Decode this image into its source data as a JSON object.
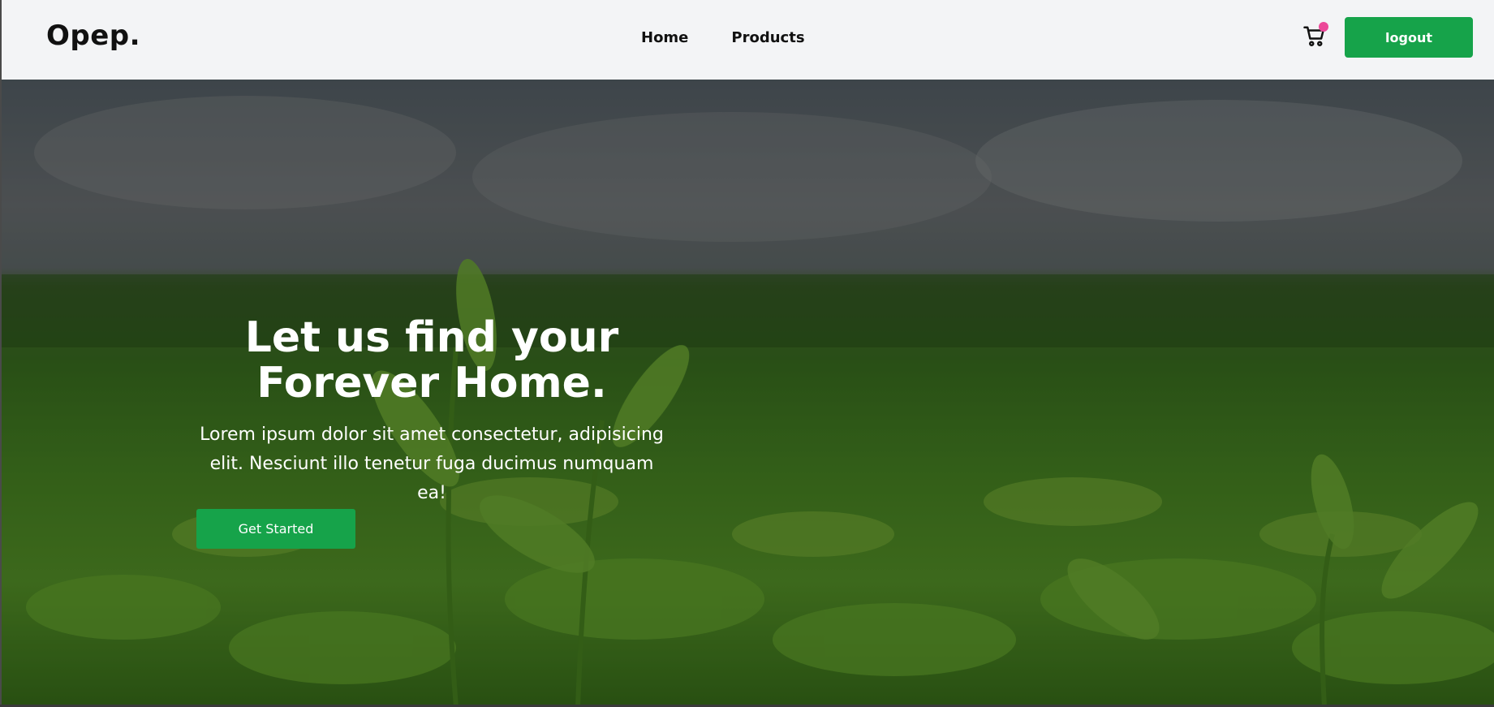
{
  "header": {
    "logo": "Opep.",
    "nav": [
      {
        "label": "Home"
      },
      {
        "label": "Products"
      }
    ],
    "cart_icon": "shopping-cart-icon",
    "logout_label": "logout"
  },
  "hero": {
    "title": "Let us find your\nForever Home.",
    "text": "Lorem ipsum dolor sit amet consectetur, adipisicing elit. Nesciunt illo tenetur fuga ducimus numquam ea!",
    "cta_label": "Get Started"
  },
  "colors": {
    "accent": "#16a34a",
    "badge": "#ec4899",
    "header_bg": "#f3f4f6"
  }
}
